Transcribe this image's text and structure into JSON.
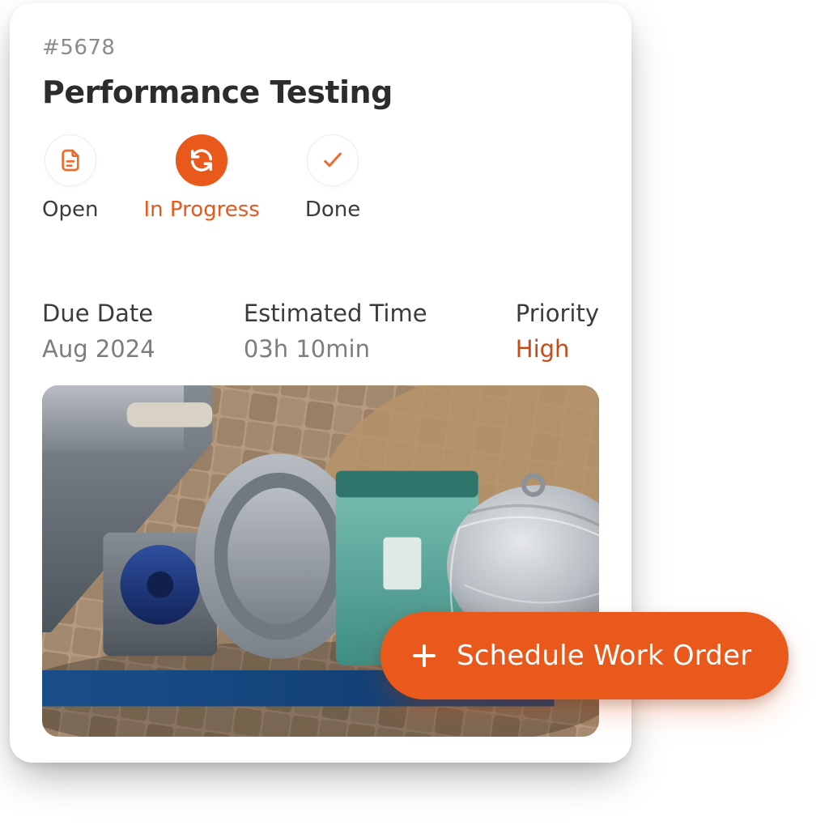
{
  "order": {
    "id": "#5678",
    "title": "Performance Testing"
  },
  "status": {
    "open": "Open",
    "in_progress": "In Progress",
    "done": "Done",
    "active": "in_progress"
  },
  "meta": {
    "due_label": "Due Date",
    "due_value": "Aug 2024",
    "time_label": "Estimated Time",
    "time_value": "03h 10min",
    "priority_label": "Priority",
    "priority_value": "High"
  },
  "fab": {
    "label": "Schedule Work Order"
  },
  "colors": {
    "accent": "#e9591c"
  }
}
